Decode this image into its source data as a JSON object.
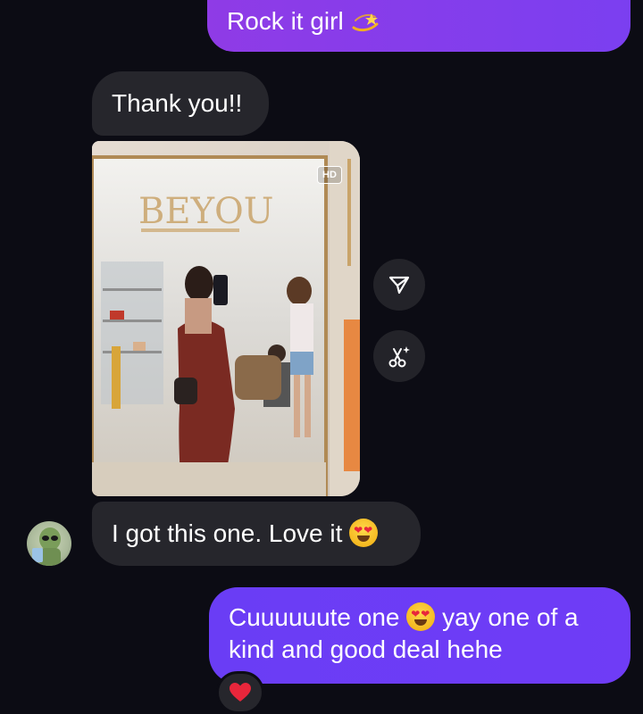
{
  "messages": {
    "outgoing_1": {
      "text": "Rock it girl",
      "emoji": "dizzy-star"
    },
    "incoming_1": {
      "text": "Thank you!!"
    },
    "photo": {
      "badge": "HD",
      "sign_text": "BEYOU"
    },
    "incoming_2": {
      "text": "I got this one. Love it",
      "emoji": "heart-eyes"
    },
    "outgoing_2": {
      "text_before_emoji": "Cuuuuuute one",
      "text_after_emoji": "yay one of a kind and good deal hehe",
      "emoji": "heart-eyes"
    },
    "reaction": {
      "emoji": "red-heart"
    }
  },
  "actions": {
    "share_icon": "send-icon",
    "ai_edit_icon": "scissors-sparkle-icon"
  },
  "colors": {
    "background": "#0c0c14",
    "incoming_bubble": "#26262c",
    "outgoing_bubble_top": "#8f3be6",
    "outgoing_bubble_bottom": "#6a3df5"
  }
}
